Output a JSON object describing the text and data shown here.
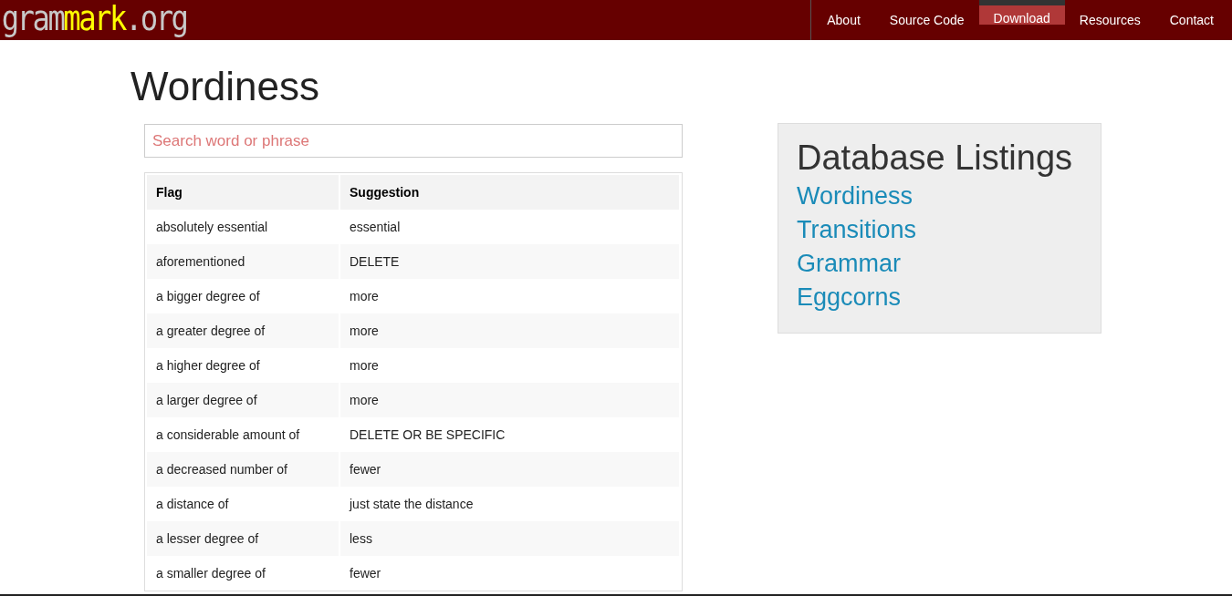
{
  "logo": {
    "parts": [
      {
        "text": "gram",
        "highlight": false
      },
      {
        "text": "mark",
        "highlight": true
      },
      {
        "text": ".org",
        "highlight": false
      }
    ]
  },
  "nav": [
    {
      "label": "About",
      "selected": false
    },
    {
      "label": "Source Code",
      "selected": false
    },
    {
      "label": "Download",
      "selected": true
    },
    {
      "label": "Resources",
      "selected": false
    },
    {
      "label": "Contact",
      "selected": false
    }
  ],
  "title": "Wordiness",
  "search": {
    "placeholder": "Search word or phrase"
  },
  "table": {
    "columns": [
      "Flag",
      "Suggestion"
    ],
    "rows": [
      [
        "absolutely essential",
        "essential"
      ],
      [
        "aforementioned",
        "DELETE"
      ],
      [
        "a bigger degree of",
        "more"
      ],
      [
        "a greater degree of",
        "more"
      ],
      [
        "a higher degree of",
        "more"
      ],
      [
        "a larger degree of",
        "more"
      ],
      [
        "a considerable amount of",
        "DELETE OR BE SPECIFIC"
      ],
      [
        "a decreased number of",
        "fewer"
      ],
      [
        "a distance of",
        "just state the distance"
      ],
      [
        "a lesser degree of",
        "less"
      ],
      [
        "a smaller degree of",
        "fewer"
      ]
    ]
  },
  "sidebar": {
    "title": "Database Listings",
    "links": [
      "Wordiness",
      "Transitions",
      "Grammar",
      "Eggcorns"
    ]
  }
}
